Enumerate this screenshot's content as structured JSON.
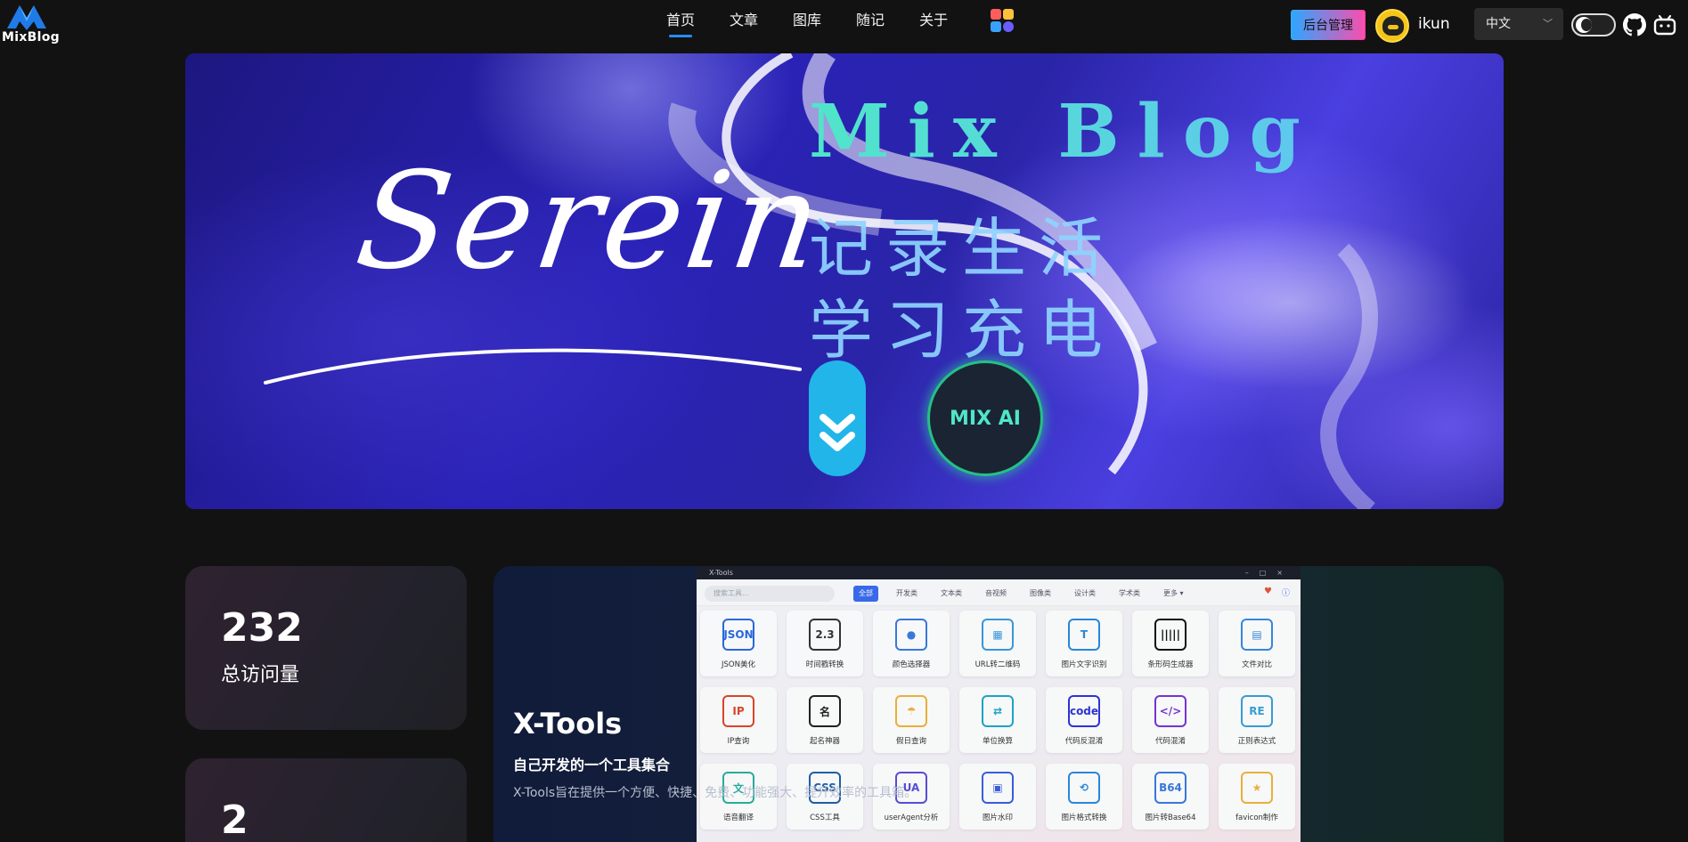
{
  "header": {
    "logo_text": "MixBlog",
    "nav": [
      {
        "label": "首页",
        "active": true
      },
      {
        "label": "文章",
        "active": false
      },
      {
        "label": "图库",
        "active": false
      },
      {
        "label": "随记",
        "active": false
      },
      {
        "label": "关于",
        "active": false
      }
    ],
    "admin_label": "后台管理",
    "username": "ikun",
    "language": "中文",
    "icons": [
      "apps-icon",
      "theme-toggle-icon",
      "github-icon",
      "bilibili-icon"
    ]
  },
  "banner": {
    "script_text": "Serein",
    "title": "Mix Blog",
    "slogan_line1": "记录生活",
    "slogan_line2": "学习充电",
    "ai_button": "MIX AI",
    "scroll_icon": "double-chevron-down-icon"
  },
  "stats": [
    {
      "value": "232",
      "label": "总访问量"
    },
    {
      "value": "2",
      "label": ""
    }
  ],
  "tools": {
    "title": "X-Tools",
    "subtitle": "自己开发的一个工具集合",
    "description": "X-Tools旨在提供一个方便、快捷、免费、功能强大、提升效率的工具箱。",
    "window_title": "X-Tools",
    "search_placeholder": "搜索工具...",
    "tabs": [
      "全部",
      "开发类",
      "文本类",
      "音视频",
      "图像类",
      "设计类",
      "学术类",
      "更多 ▾"
    ],
    "items": [
      {
        "label": "JSON美化",
        "icon": "json-icon",
        "glyph": "JSON",
        "color": "#2b6be0"
      },
      {
        "label": "时间戳转换",
        "icon": "calendar-icon",
        "glyph": "2.3",
        "color": "#333333"
      },
      {
        "label": "颜色选择器",
        "icon": "palette-icon",
        "glyph": "●",
        "color": "#3a7be0"
      },
      {
        "label": "URL转二维码",
        "icon": "qrcode-icon",
        "glyph": "▦",
        "color": "#3a9be0"
      },
      {
        "label": "图片文字识别",
        "icon": "ocr-icon",
        "glyph": "T",
        "color": "#2a8ae0"
      },
      {
        "label": "条形码生成器",
        "icon": "barcode-icon",
        "glyph": "|||||",
        "color": "#111111"
      },
      {
        "label": "文件对比",
        "icon": "file-compare-icon",
        "glyph": "▤",
        "color": "#3a8ae0"
      },
      {
        "label": "IP查询",
        "icon": "ip-search-icon",
        "glyph": "IP",
        "color": "#e0462a"
      },
      {
        "label": "起名神器",
        "icon": "name-icon",
        "glyph": "名",
        "color": "#222222"
      },
      {
        "label": "假日查询",
        "icon": "holiday-icon",
        "glyph": "☂",
        "color": "#f0b43a"
      },
      {
        "label": "单位换算",
        "icon": "unit-convert-icon",
        "glyph": "⇄",
        "color": "#1ea8c8"
      },
      {
        "label": "代码反混淆",
        "icon": "code-deobfuscate-icon",
        "glyph": "code",
        "color": "#2f34d8"
      },
      {
        "label": "代码混淆",
        "icon": "code-obfuscate-icon",
        "glyph": "</>",
        "color": "#7a34d8"
      },
      {
        "label": "正则表达式",
        "icon": "regex-icon",
        "glyph": "RE",
        "color": "#38a0d8"
      },
      {
        "label": "语音翻译",
        "icon": "voice-translate-icon",
        "glyph": "文",
        "color": "#2ab0a0"
      },
      {
        "label": "CSS工具",
        "icon": "css-icon",
        "glyph": "CSS",
        "color": "#1f5fa8"
      },
      {
        "label": "userAgent分析",
        "icon": "useragent-icon",
        "glyph": "UA",
        "color": "#5a4fd8"
      },
      {
        "label": "图片水印",
        "icon": "watermark-icon",
        "glyph": "▣",
        "color": "#3a5fe0"
      },
      {
        "label": "图片格式转换",
        "icon": "image-convert-icon",
        "glyph": "⟲",
        "color": "#2a8ae0"
      },
      {
        "label": "图片转Base64",
        "icon": "base64-icon",
        "glyph": "B64",
        "color": "#3a7ae0"
      },
      {
        "label": "favicon制作",
        "icon": "favicon-icon",
        "glyph": "★",
        "color": "#f0b43a"
      }
    ]
  }
}
